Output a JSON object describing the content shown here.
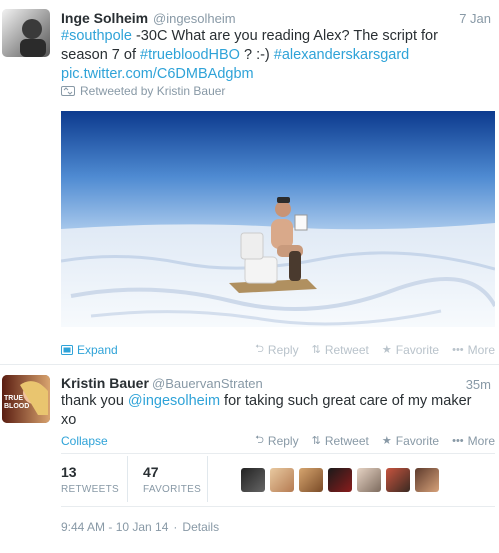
{
  "tweet1": {
    "name": "Inge Solheim",
    "handle": "@ingesolheim",
    "time": "7 Jan",
    "text_parts": [
      {
        "t": "#southpole",
        "link": true
      },
      {
        "t": " -30C What are you reading Alex? The script for season 7 of ",
        "link": false
      },
      {
        "t": "#truebloodHBO",
        "link": true
      },
      {
        "t": " ? :-) ",
        "link": false
      },
      {
        "t": "#alexanderskarsgard",
        "link": true
      }
    ],
    "pic_link": "pic.twitter.com/C6DMBAdgbm",
    "retweeted_by": "Retweeted by Kristin Bauer",
    "expand_label": "Expand",
    "actions": [
      "Reply",
      "Retweet",
      "Favorite",
      "More"
    ]
  },
  "tweet2": {
    "name": "Kristin Bauer",
    "handle": "@BauervanStraten",
    "time": "35m",
    "text_before": "thank you ",
    "mention": "@ingesolheim",
    "text_after": " for taking such great care of my maker xo",
    "collapse_label": "Collapse",
    "actions": [
      "Reply",
      "Retweet",
      "Favorite",
      "More"
    ],
    "retweets_count": "13",
    "retweets_label": "RETWEETS",
    "favorites_count": "47",
    "favorites_label": "FAVORITES",
    "timestamp": "9:44 AM - 10 Jan 14",
    "details_label": "Details",
    "avatar_text": "TRUE BLOOD"
  },
  "colors": {
    "link": "#2fa3d8",
    "sky_top": "#0c3a8e",
    "sky_bottom": "#7fb3e6",
    "snow": "#eef3fa"
  }
}
